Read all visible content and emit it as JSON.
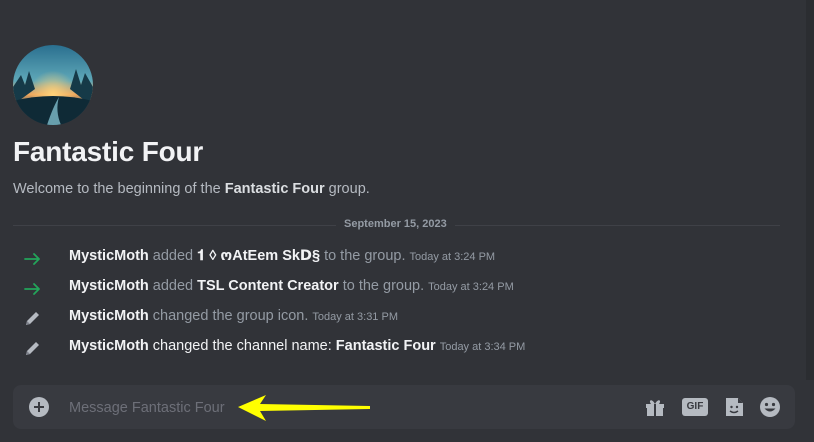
{
  "group": {
    "name": "Fantastic Four",
    "welcome_prefix": "Welcome to the beginning of the ",
    "welcome_name": "Fantastic Four",
    "welcome_suffix": " group."
  },
  "date_divider": "September 15, 2023",
  "messages": [
    {
      "icon": "join-arrow-icon",
      "user": "MysticMoth",
      "action": "added",
      "target": "𝟏 ◊ ოAtEem SkⅮ§",
      "suffix": "to the group.",
      "time": "Today at 3:24 PM"
    },
    {
      "icon": "join-arrow-icon",
      "user": "MysticMoth",
      "action": "added",
      "target": "TSL Content Creator",
      "suffix": "to the group.",
      "time": "Today at 3:24 PM"
    },
    {
      "icon": "pencil-icon",
      "user": "MysticMoth",
      "action": "changed the group icon.",
      "time": "Today at 3:31 PM"
    },
    {
      "icon": "pencil-icon",
      "user": "MysticMoth",
      "action": "changed the channel name:",
      "target": "Fantastic Four",
      "time": "Today at 3:34 PM"
    }
  ],
  "composer": {
    "placeholder": "Message Fantastic Four",
    "gif_label": "GIF"
  },
  "colors": {
    "background": "#313338",
    "composer": "#383a40",
    "join_arrow": "#23a55a",
    "annotation_arrow": "#ffff00"
  }
}
